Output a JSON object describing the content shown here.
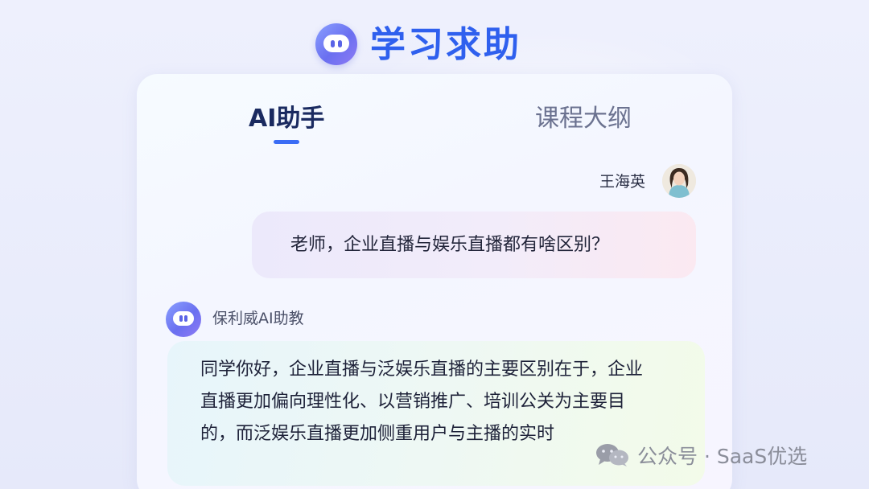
{
  "header": {
    "title": "学习求助",
    "logo_icon": "robot-icon"
  },
  "tabs": [
    {
      "label": "AI助手",
      "active": true
    },
    {
      "label": "课程大纲",
      "active": false
    }
  ],
  "user_message": {
    "name": "王海英",
    "text": "老师，企业直播与娱乐直播都有啥区别？"
  },
  "bot_message": {
    "name": "保利威AI助教",
    "text": "同学你好，企业直播与泛娱乐直播的主要区别在于，企业直播更加偏向理性化、以营销推广、培训公关为主要目的，而泛娱乐直播更加侧重用户与主播的实时"
  },
  "watermark": {
    "text": "公众号 · SaaS优选",
    "icon": "wechat-icon"
  },
  "colors": {
    "accent": "#2f60ee",
    "tab_underline": "#3a6cf5"
  }
}
